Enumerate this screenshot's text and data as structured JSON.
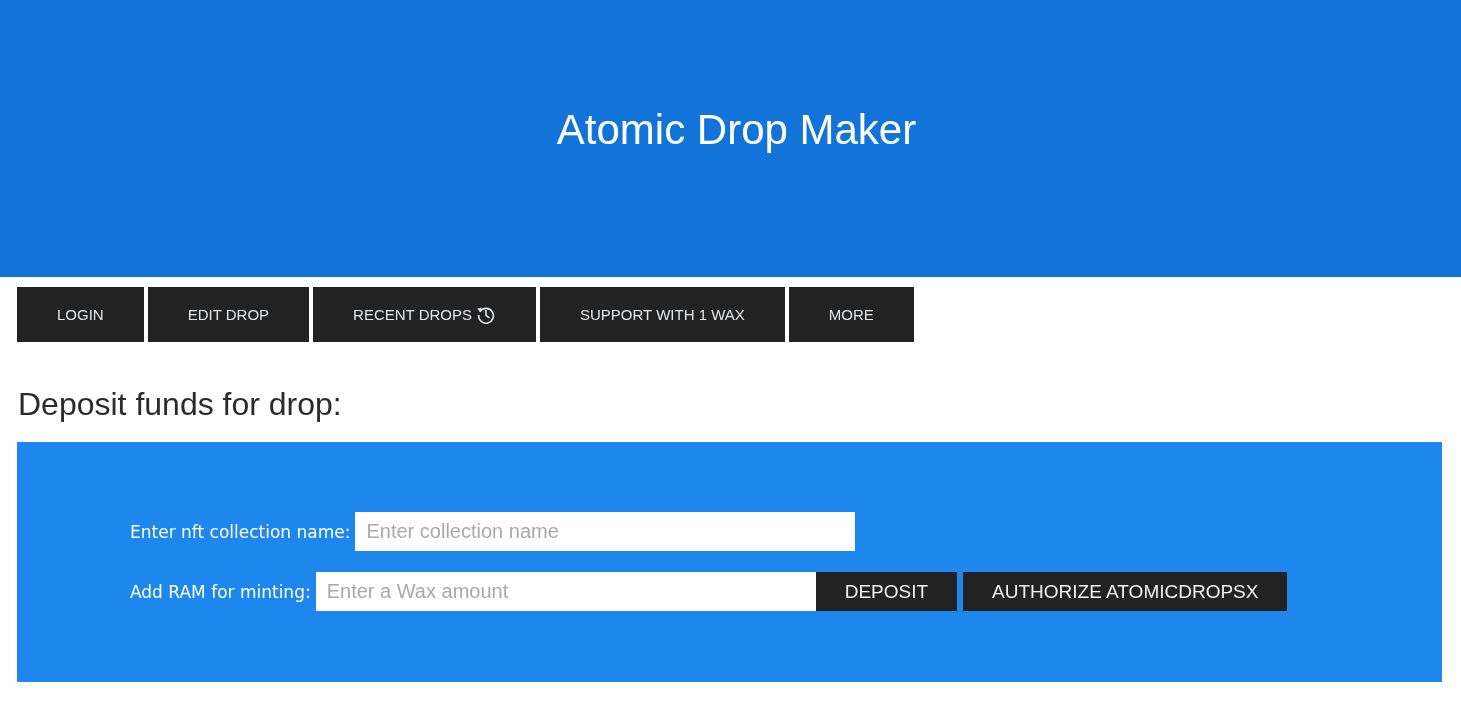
{
  "header": {
    "title": "Atomic Drop Maker"
  },
  "nav": [
    {
      "label": "LOGIN",
      "kind": "plain"
    },
    {
      "label": "EDIT DROP",
      "kind": "plain"
    },
    {
      "label": "RECENT DROPS",
      "kind": "icon"
    },
    {
      "label": "SUPPORT WITH 1 WAX",
      "kind": "plain"
    },
    {
      "label": "MORE",
      "kind": "plain"
    }
  ],
  "section": {
    "heading": "Deposit funds for drop:"
  },
  "form": {
    "rows": [
      {
        "label": "Enter nft collection name:",
        "placeholder": "Enter collection name"
      },
      {
        "label": "Add RAM for minting:",
        "placeholder": "Enter a Wax amount",
        "buttons": [
          "DEPOSIT",
          "AUTHORIZE ATOMICDROPSX"
        ]
      }
    ]
  }
}
